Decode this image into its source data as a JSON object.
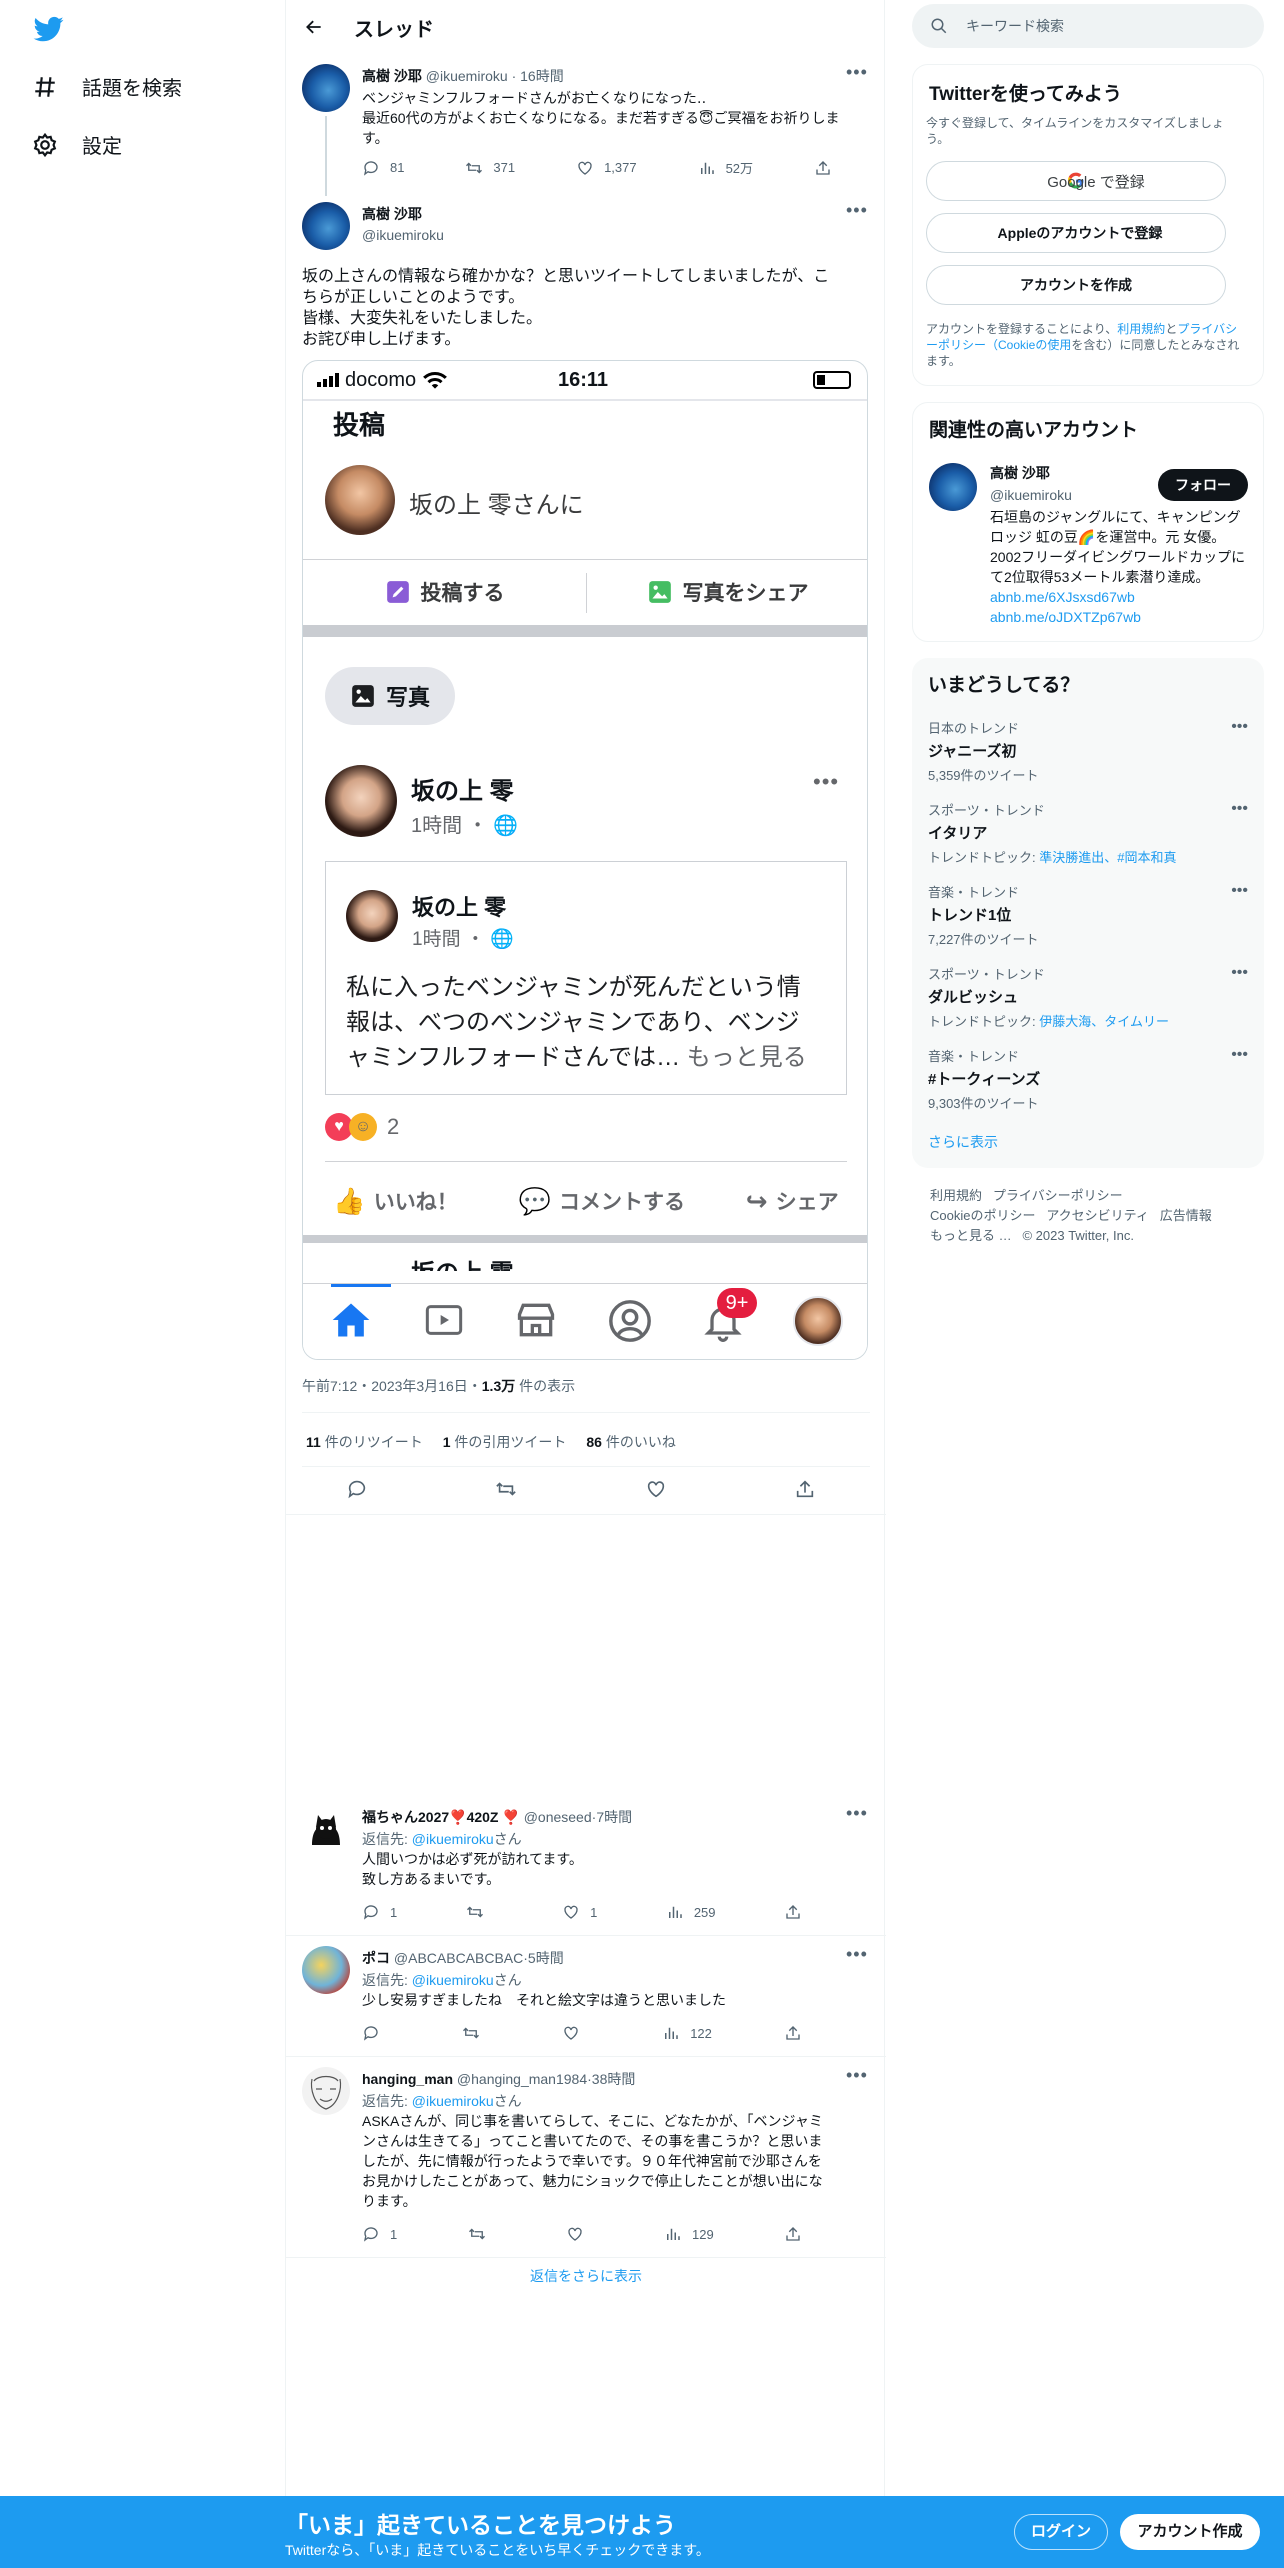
{
  "sidebar": {
    "items": [
      {
        "label": "話題を検索",
        "icon": "hashtag-icon"
      },
      {
        "label": "設定",
        "icon": "gear-icon"
      }
    ]
  },
  "header": {
    "title": "スレッド"
  },
  "parent_tweet": {
    "name": "高樹 沙耶",
    "handle": "@ikuemiroku",
    "time": "16時間",
    "text1": "ベンジャミンフルフォードさんがお亡くなりになった‥",
    "text2": "最近60代の方がよくお亡くなりになる。まだ若すぎる😇ご冥福をお祈りします。",
    "replies": "81",
    "retweets": "371",
    "likes": "1,377",
    "views": "52万"
  },
  "main_tweet": {
    "name": "高樹 沙耶",
    "handle": "@ikuemiroku",
    "text": [
      "坂の上さんの情報なら確かかな？と思いツイートしてしまいましたが、こ",
      "ちらが正しいことのようです。",
      "皆様、大変失礼をいたしました。",
      "お詫び申し上げます。"
    ],
    "meta_time": "午前7:12・2023年3月16日・",
    "meta_views_num": "1.3万",
    "meta_views_label": "件の表示",
    "stats": [
      {
        "num": "11",
        "label": "件のリツイート"
      },
      {
        "num": "1",
        "label": "件の引用ツイート"
      },
      {
        "num": "86",
        "label": "件のいいね"
      }
    ]
  },
  "screenshot": {
    "carrier": "docomo",
    "clock": "16:11",
    "post_header": "投稿",
    "composer_placeholder": "坂の上 零さんに",
    "btn_post": "投稿する",
    "btn_photo_share": "写真をシェア",
    "photo_chip": "写真",
    "post_name": "坂の上 零",
    "post_time": "1時間 ・",
    "shared_name": "坂の上 零",
    "shared_time": "1時間 ・",
    "shared_text1": "私に入ったベンジャミンが死んだという情",
    "shared_text2": "報は、べつのベンジャミンであり、ベンジ",
    "shared_text3": "ャミンフルフォードさんでは… ",
    "see_more": "もっと見る",
    "reaction_count": "2",
    "like_btn": "いいね！",
    "comment_btn": "コメントする",
    "share_btn": "シェア",
    "next_name": "坂の上 零",
    "notif_badge": "9+"
  },
  "replies": [
    {
      "name": "福ちゃん2027❣️420Z ❣️",
      "handle": "@oneseed",
      "time": "7時間",
      "reply_prefix": "返信先: ",
      "reply_to": "@ikuemiroku",
      "reply_suffix": "さん",
      "text": [
        "人間いつかは必ず死が訪れてます。",
        "致し方あるまいです。"
      ],
      "replies": "1",
      "retweets": "",
      "likes": "1",
      "views": "259"
    },
    {
      "name": "ポコ",
      "handle": "@ABCABCABCBAC",
      "time": "5時間",
      "reply_prefix": "返信先: ",
      "reply_to": "@ikuemiroku",
      "reply_suffix": "さん",
      "text": [
        "少し安易すぎましたね　それと絵文字は違うと思いました"
      ],
      "replies": "",
      "retweets": "",
      "likes": "",
      "views": "122"
    },
    {
      "name": "hanging_man",
      "handle": "@hanging_man1984",
      "time": "38時間",
      "reply_prefix": "返信先: ",
      "reply_to": "@ikuemiroku",
      "reply_suffix": "さん",
      "text": [
        "ASKAさんが、同じ事を書いてらして、そこに、どなたかが、「ベンジャミ",
        "ンさんは生きてる」ってこと書いてたので、その事を書こうか？と思いま",
        "したが、先に情報が行ったようで幸いです。９０年代神宮前で沙耶さんを",
        "お見かけしたことがあって、魅力にショックで停止したことが想い出にな",
        "ります。"
      ],
      "replies": "1",
      "retweets": "",
      "likes": "",
      "views": "129"
    }
  ],
  "show_more_replies": "返信をさらに表示",
  "right": {
    "search_placeholder": "キーワード検索",
    "signup": {
      "title": "Twitterを使ってみよう",
      "sub": "今すぐ登録して、タイムラインをカスタマイズしましょう。",
      "google": "Google で登録",
      "apple": "Appleのアカウントで登録",
      "create": "アカウントを作成",
      "terms_pre": "アカウントを登録することにより、",
      "terms_link1": "利用規約",
      "terms_mid": "と",
      "terms_link2": "プライバシーポリシー（Cookieの使用",
      "terms_post": "を含む）に同意したとみなされます。"
    },
    "related": {
      "title": "関連性の高いアカウント",
      "name": "高樹 沙耶",
      "handle": "@ikuemiroku",
      "follow": "フォロー",
      "bio": "石垣島のジャングルにて、キャンピングロッジ 虹の豆🌈を運営中。元 女優。2002フリーダイビングワールドカップにて2位取得53メートル素潜り達成。",
      "link1": "abnb.me/6XJsxsd67wb",
      "link2": "abnb.me/oJDXTZp67wb"
    },
    "trends": {
      "title": "いまどうしてる？",
      "items": [
        {
          "cat": "日本のトレンド",
          "topic": "ジャニーズ初",
          "count": "5,359件のツイート",
          "sub_pre": "",
          "sub_links": ""
        },
        {
          "cat": "スポーツ・トレンド",
          "topic": "イタリア",
          "count": "",
          "sub_pre": "トレンドトピック: ",
          "sub_links": "準決勝進出、#岡本和真"
        },
        {
          "cat": "音楽・トレンド",
          "topic": "トレンド1位",
          "count": "7,227件のツイート",
          "sub_pre": "",
          "sub_links": ""
        },
        {
          "cat": "スポーツ・トレンド",
          "topic": "ダルビッシュ",
          "count": "",
          "sub_pre": "トレンドトピック: ",
          "sub_links": "伊藤大海、タイムリー"
        },
        {
          "cat": "音楽・トレンド",
          "topic": "#トークィーンズ",
          "count": "9,303件のツイート",
          "sub_pre": "",
          "sub_links": ""
        }
      ],
      "more": "さらに表示"
    },
    "footer": [
      "利用規約",
      "プライバシーポリシー",
      "Cookieのポリシー",
      "アクセシビリティ",
      "広告情報",
      "もっと見る …",
      "© 2023 Twitter, Inc."
    ]
  },
  "bottom": {
    "headline": "「いま」起きていることを見つけよう",
    "sub": "Twitterなら、「いま」起きていることをいち早くチェックできます。",
    "login": "ログイン",
    "signup": "アカウント作成"
  }
}
